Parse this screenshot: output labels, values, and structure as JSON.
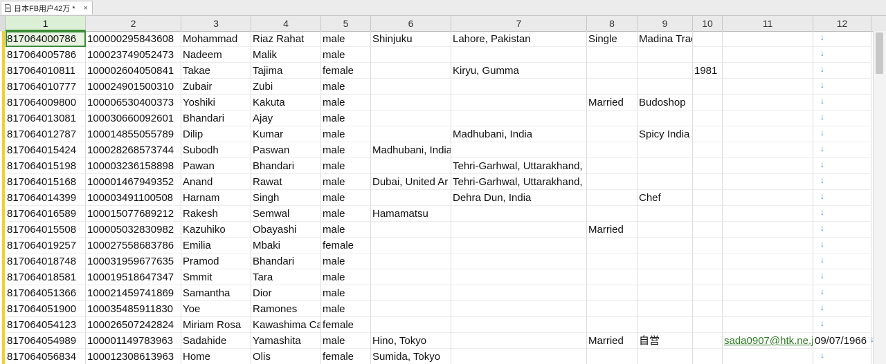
{
  "tab": {
    "title": "日本FB用户42万 *",
    "close": "×"
  },
  "columns": [
    "1",
    "2",
    "3",
    "4",
    "5",
    "6",
    "7",
    "8",
    "9",
    "10",
    "11",
    "12"
  ],
  "rows": [
    [
      "817064000786",
      "100000295843608",
      "Mohammad",
      "Riaz Rahat",
      "male",
      "Shinjuku",
      "Lahore, Pakistan",
      "Single",
      "Madina Trac",
      "",
      "",
      ""
    ],
    [
      "817064005786",
      "100023749052473",
      "Nadeem",
      "Malik",
      "male",
      "",
      "",
      "",
      "",
      "",
      "",
      ""
    ],
    [
      "817064010811",
      "100002604050841",
      "Takae",
      "Tajima",
      "female",
      "",
      "Kiryu, Gumma",
      "",
      "",
      "1981",
      "",
      ""
    ],
    [
      "817064010777",
      "100024901500310",
      "Zubair",
      "Zubi",
      "male",
      "",
      "",
      "",
      "",
      "",
      "",
      ""
    ],
    [
      "817064009800",
      "100006530400373",
      "Yoshiki",
      "Kakuta",
      "male",
      "",
      "",
      "Married",
      "Budoshop",
      "",
      "",
      ""
    ],
    [
      "817064013081",
      "100030660092601",
      "Bhandari",
      "Ajay",
      "male",
      "",
      "",
      "",
      "",
      "",
      "",
      ""
    ],
    [
      "817064012787",
      "100014855055789",
      "Dilip",
      "Kumar",
      "male",
      "",
      "Madhubani, India",
      "",
      "Spicy India",
      "",
      "",
      ""
    ],
    [
      "817064015424",
      "100028268573744",
      "Subodh",
      "Paswan",
      "male",
      "Madhubani, India",
      "",
      "",
      "",
      "",
      "",
      ""
    ],
    [
      "817064015198",
      "100003236158898",
      "Pawan",
      "Bhandari",
      "male",
      "",
      "Tehri-Garhwal, Uttarakhand,",
      "",
      "",
      "",
      "",
      ""
    ],
    [
      "817064015168",
      "100001467949352",
      "Anand",
      "Rawat",
      "male",
      "Dubai, United Ar",
      "Tehri-Garhwal, Uttarakhand,",
      "",
      "",
      "",
      "",
      ""
    ],
    [
      "817064014399",
      "100003491100508",
      "Harnam",
      "Singh",
      "male",
      "",
      "Dehra Dun, India",
      "",
      "Chef",
      "",
      "",
      ""
    ],
    [
      "817064016589",
      "100015077689212",
      "Rakesh",
      "Semwal",
      "male",
      "Hamamatsu",
      "",
      "",
      "",
      "",
      "",
      ""
    ],
    [
      "817064015508",
      "100005032830982",
      "Kazuhiko",
      "Obayashi",
      "male",
      "",
      "",
      "Married",
      "",
      "",
      "",
      ""
    ],
    [
      "817064019257",
      "100027558683786",
      "Emilia",
      "Mbaki",
      "female",
      "",
      "",
      "",
      "",
      "",
      "",
      ""
    ],
    [
      "817064018748",
      "100031959677635",
      "Pramod",
      "Bhandari",
      "male",
      "",
      "",
      "",
      "",
      "",
      "",
      ""
    ],
    [
      "817064018581",
      "100019518647347",
      "Smmit",
      "Tara",
      "male",
      "",
      "",
      "",
      "",
      "",
      "",
      ""
    ],
    [
      "817064051366",
      "100021459741869",
      "Samantha",
      "Dior",
      "male",
      "",
      "",
      "",
      "",
      "",
      "",
      ""
    ],
    [
      "817064051900",
      "100035485911830",
      "Yoe",
      "Ramones",
      "male",
      "",
      "",
      "",
      "",
      "",
      "",
      ""
    ],
    [
      "817064054123",
      "100026507242824",
      "Miriam Rosa",
      "Kawashima Cal",
      "female",
      "",
      "",
      "",
      "",
      "",
      "",
      ""
    ],
    [
      "817064054989",
      "100001149783963",
      "Sadahide",
      "Yamashita",
      "male",
      "Hino, Tokyo",
      "",
      "Married",
      "自営",
      "",
      "sada0907@htk.ne.j",
      "09/07/1966"
    ],
    [
      "817064056834",
      "100012308613963",
      "Home",
      "Olis",
      "female",
      "Sumida, Tokyo",
      "",
      "",
      "",
      "",
      "",
      ""
    ]
  ],
  "line_arrow": "↓"
}
